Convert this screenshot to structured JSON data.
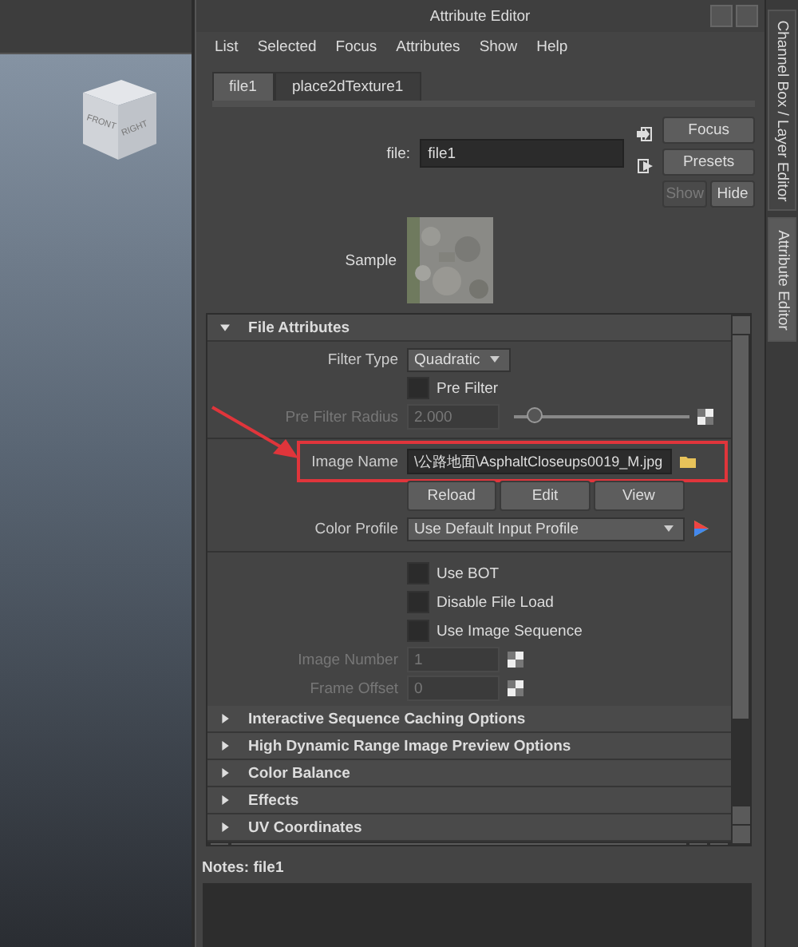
{
  "viewport": {
    "cube_faces": [
      "FRONT",
      "RIGHT"
    ]
  },
  "window": {
    "title": "Attribute Editor"
  },
  "menu": [
    "List",
    "Selected",
    "Focus",
    "Attributes",
    "Show",
    "Help"
  ],
  "tabs": [
    {
      "label": "file1",
      "selected": true
    },
    {
      "label": "place2dTexture1",
      "selected": false
    }
  ],
  "node": {
    "label": "file:",
    "value": "file1"
  },
  "buttons": [
    {
      "label": "Focus",
      "disabled": false
    },
    {
      "label": "Presets",
      "disabled": false
    }
  ],
  "visibility_buttons": [
    {
      "label": "Show",
      "disabled": true
    },
    {
      "label": "Hide",
      "disabled": false
    }
  ],
  "sample": {
    "label": "Sample"
  },
  "sections": [
    {
      "title": "File Attributes",
      "expanded": true,
      "rows": [
        {
          "kind": "dropdown",
          "label": "Filter Type",
          "value": "Quadratic"
        },
        {
          "kind": "checkbox",
          "label": "Pre Filter",
          "checked": false
        },
        {
          "kind": "slider",
          "label": "Pre Filter Radius",
          "value": "2.000",
          "level": 0.12,
          "disabled": true
        },
        {
          "kind": "divider"
        },
        {
          "kind": "file",
          "label": "Image Name",
          "value": "\\公路地面\\AsphaltCloseups0019_M.jpg",
          "highlight": true
        },
        {
          "kind": "buttons",
          "buttons": [
            "Reload",
            "Edit",
            "View"
          ]
        },
        {
          "kind": "profile",
          "label": "Color Profile",
          "value": "Use Default Input Profile"
        },
        {
          "kind": "divider"
        },
        {
          "kind": "checkbox",
          "label": "Use BOT",
          "checked": false
        },
        {
          "kind": "checkbox",
          "label": "Disable File Load",
          "checked": false
        },
        {
          "kind": "checkbox",
          "label": "Use Image Sequence",
          "checked": false
        },
        {
          "kind": "number",
          "label": "Image Number",
          "value": "1",
          "disabled": true
        },
        {
          "kind": "number",
          "label": "Frame Offset",
          "value": "0",
          "disabled": true
        }
      ]
    },
    {
      "title": "Interactive Sequence Caching Options",
      "expanded": false
    },
    {
      "title": "High Dynamic Range Image Preview Options",
      "expanded": false
    },
    {
      "title": "Color Balance",
      "expanded": false
    },
    {
      "title": "Effects",
      "expanded": false
    },
    {
      "title": "UV Coordinates",
      "expanded": false
    }
  ],
  "notes": {
    "label": "Notes:",
    "value": "file1"
  },
  "side_tabs": [
    {
      "label": "Channel Box / Layer Editor",
      "selected": false
    },
    {
      "label": "Attribute Editor",
      "selected": true
    }
  ]
}
